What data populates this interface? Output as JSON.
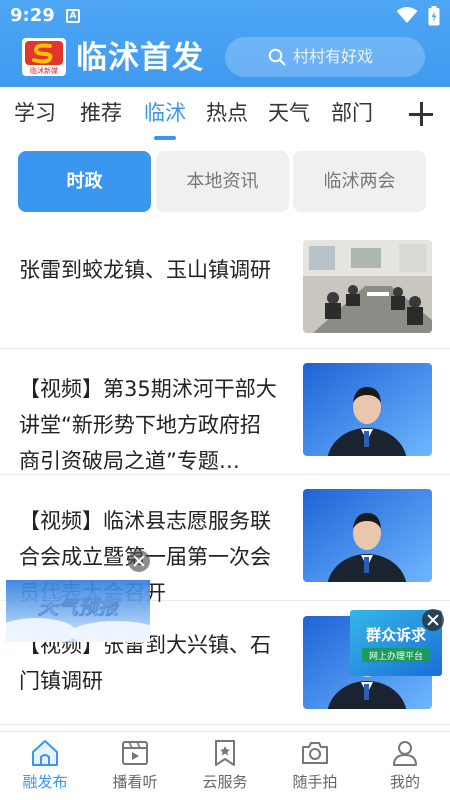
{
  "status_bar": {
    "time": "9:29",
    "notification_letter": "A"
  },
  "header": {
    "logo_text": "临沭新媒",
    "title": "临沭首发",
    "search_placeholder": "村村有好戏"
  },
  "channel_tabs": [
    {
      "label": "学习"
    },
    {
      "label": "推荐"
    },
    {
      "label": "临沭"
    },
    {
      "label": "热点"
    },
    {
      "label": "天气"
    },
    {
      "label": "部门"
    }
  ],
  "sub_tabs": [
    {
      "label": "时政"
    },
    {
      "label": "本地资讯"
    },
    {
      "label": "临沭两会"
    }
  ],
  "news": [
    {
      "title": "张雷到蛟龙镇、玉山镇调研",
      "thumb": "meeting-photo"
    },
    {
      "title": "【视频】第35期沭河干部大讲堂“新形势下地方政府招商引资破局之道”专题…",
      "thumb": "anchor-video"
    },
    {
      "title": "【视频】临沭县志愿服务联合会成立暨第一届第一次会员代表大会召开",
      "thumb": "anchor-video"
    },
    {
      "title": "【视频】张雷到大兴镇、石门镇调研",
      "thumb": "anchor-video"
    }
  ],
  "floating": {
    "weather_label": "天气预报",
    "appeal_title": "群众诉求",
    "appeal_sub": "网上办理平台"
  },
  "bottom_nav": [
    {
      "label": "融发布",
      "icon": "home-icon"
    },
    {
      "label": "播看听",
      "icon": "video-icon"
    },
    {
      "label": "云服务",
      "icon": "bookmark-star-icon"
    },
    {
      "label": "随手拍",
      "icon": "camera-icon"
    },
    {
      "label": "我的",
      "icon": "user-icon"
    }
  ],
  "colors": {
    "accent": "#3a96ee",
    "header": "#4ea6f4"
  }
}
